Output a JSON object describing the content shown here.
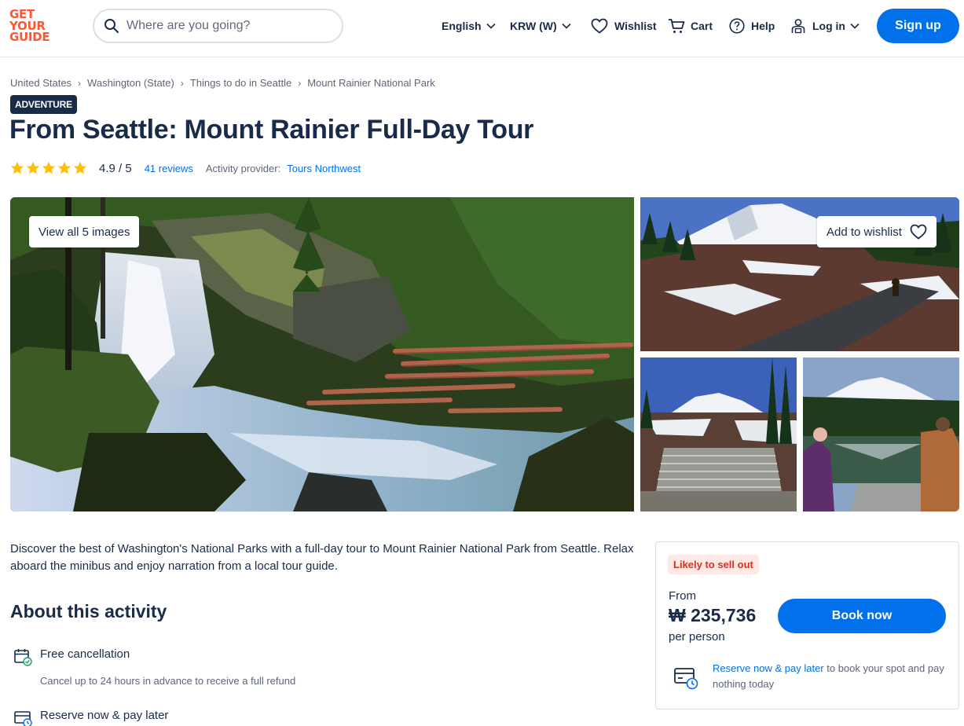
{
  "header": {
    "logo_lines": [
      "GET",
      "YOUR",
      "GUIDE"
    ],
    "search_placeholder": "Where are you going?",
    "language": "English",
    "currency": "KRW (W)",
    "wishlist": "Wishlist",
    "cart": "Cart",
    "help": "Help",
    "login": "Log in",
    "signup": "Sign up"
  },
  "breadcrumb": [
    "United States",
    "Washington (State)",
    "Things to do in Seattle",
    "Mount Rainier National Park"
  ],
  "badge": "ADVENTURE",
  "title": "From Seattle: Mount Rainier Full-Day Tour",
  "rating": {
    "stars": 5,
    "value": "4.9 / 5",
    "reviews": "41 reviews",
    "provider_label": "Activity provider:",
    "provider": "Tours Northwest"
  },
  "gallery": {
    "view_all": "View all 5 images",
    "wishlist": "Add to wishlist"
  },
  "description": "Discover the best of Washington's National Parks with a full-day tour to Mount Rainier National Park from Seattle. Relax aboard the minibus and enjoy narration from a local tour guide.",
  "about": {
    "heading": "About this activity",
    "features": [
      {
        "title": "Free cancellation",
        "subtitle": "Cancel up to 24 hours in advance to receive a full refund"
      },
      {
        "title": "Reserve now & pay later"
      }
    ]
  },
  "booking": {
    "likely": "Likely to sell out",
    "from": "From",
    "price": "₩ 235,736",
    "per": "per person",
    "book": "Book now",
    "reserve_link": "Reserve now & pay later",
    "reserve_text": " to book your spot and pay nothing today"
  },
  "colors": {
    "brand": "#ff5533",
    "primary": "#0071eb",
    "text": "#1a2b49",
    "star": "#ffc107"
  }
}
